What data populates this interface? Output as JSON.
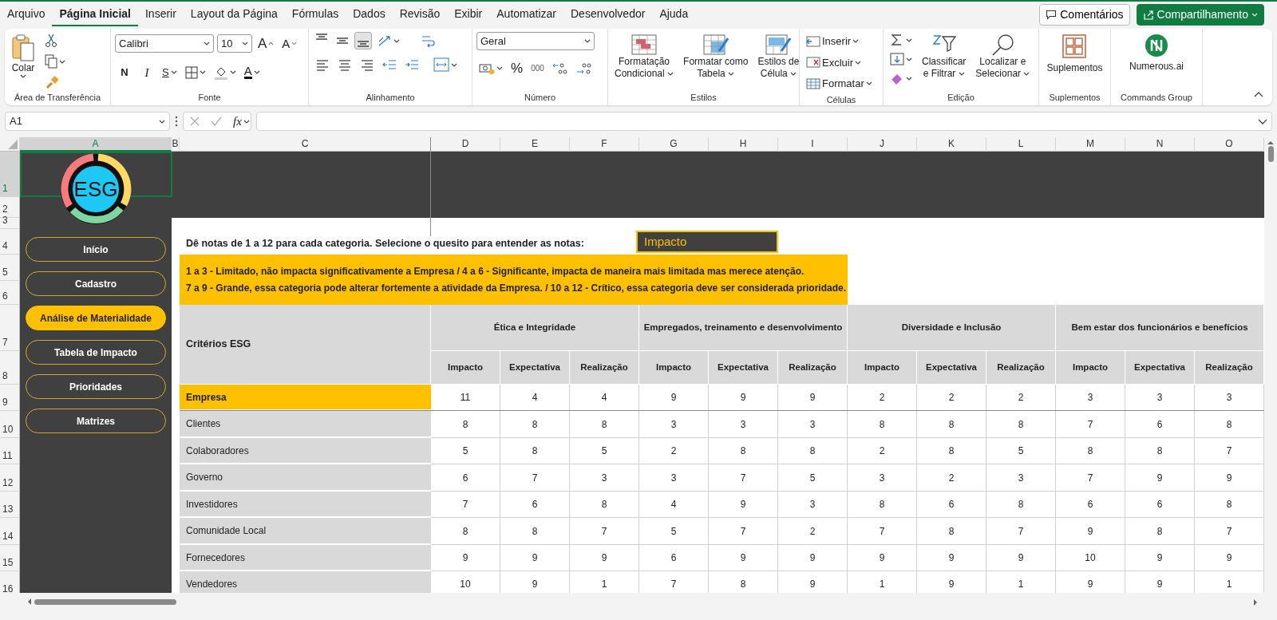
{
  "menu_tabs": [
    {
      "label": "Arquivo",
      "selected": false
    },
    {
      "label": "Página Inicial",
      "selected": true
    },
    {
      "label": "Inserir",
      "selected": false
    },
    {
      "label": "Layout da Página",
      "selected": false
    },
    {
      "label": "Fórmulas",
      "selected": false
    },
    {
      "label": "Dados",
      "selected": false
    },
    {
      "label": "Revisão",
      "selected": false
    },
    {
      "label": "Exibir",
      "selected": false
    },
    {
      "label": "Automatizar",
      "selected": false
    },
    {
      "label": "Desenvolvedor",
      "selected": false
    },
    {
      "label": "Ajuda",
      "selected": false
    }
  ],
  "header_buttons": {
    "comments": "Comentários",
    "share": "Compartilhamento"
  },
  "ribbon": [
    {
      "kind": "clipboard",
      "label": "Área de Transferência",
      "paste": "Colar"
    },
    {
      "kind": "font",
      "label": "Fonte",
      "font_name": "Calibri",
      "font_size": "10",
      "grow": "A",
      "shrink": "A",
      "bold": "N",
      "italic": "I",
      "underline": "S",
      "font_color": "A"
    },
    {
      "kind": "alignment",
      "label": "Alinhamento",
      "vertical": [
        {
          "selected": false
        },
        {
          "selected": false
        },
        {
          "selected": true
        }
      ]
    },
    {
      "kind": "number",
      "label": "Número",
      "format": "Geral",
      "percent": "%",
      "thousands": "000"
    },
    {
      "kind": "styles",
      "label": "Estilos",
      "buttons": [
        {
          "lines": [
            "Formatação",
            "Condicional"
          ]
        },
        {
          "lines": [
            "Formatar como",
            "Tabela"
          ]
        },
        {
          "lines": [
            "Estilos de",
            "Célula"
          ]
        }
      ]
    },
    {
      "kind": "cells",
      "label": "Células",
      "buttons": [
        "Inserir",
        "Excluir",
        "Formatar"
      ]
    },
    {
      "kind": "editing",
      "label": "Edição",
      "buttons": [
        {
          "lines": [
            "Classificar",
            "e Filtrar"
          ]
        },
        {
          "lines": [
            "Localizar e",
            "Selecionar"
          ]
        }
      ]
    },
    {
      "kind": "addins",
      "label": "Suplementos",
      "button": "Suplementos"
    },
    {
      "kind": "commands",
      "label": "Commands Group",
      "button": "Numerous.ai"
    }
  ],
  "formula_bar": {
    "name_box": "A1",
    "fx": "fx"
  },
  "columns": [
    {
      "label": "A",
      "selected": true
    },
    {
      "label": "B",
      "selected": false
    },
    {
      "label": "C",
      "selected": false
    },
    {
      "label": "D",
      "selected": false
    },
    {
      "label": "E",
      "selected": false
    },
    {
      "label": "F",
      "selected": false
    },
    {
      "label": "G",
      "selected": false
    },
    {
      "label": "H",
      "selected": false
    },
    {
      "label": "I",
      "selected": false
    },
    {
      "label": "J",
      "selected": false
    },
    {
      "label": "K",
      "selected": false
    },
    {
      "label": "L",
      "selected": false
    },
    {
      "label": "M",
      "selected": false
    },
    {
      "label": "N",
      "selected": false
    },
    {
      "label": "O",
      "selected": false
    }
  ],
  "rows": [
    {
      "label": "1",
      "selected": true
    },
    {
      "label": "2",
      "selected": false
    },
    {
      "label": "3",
      "selected": false
    },
    {
      "label": "4",
      "selected": false
    },
    {
      "label": "5",
      "selected": false
    },
    {
      "label": "6",
      "selected": false
    },
    {
      "label": "7",
      "selected": false
    },
    {
      "label": "8",
      "selected": false
    },
    {
      "label": "9",
      "selected": false
    },
    {
      "label": "10",
      "selected": false
    },
    {
      "label": "11",
      "selected": false
    },
    {
      "label": "12",
      "selected": false
    },
    {
      "label": "13",
      "selected": false
    },
    {
      "label": "14",
      "selected": false
    },
    {
      "label": "15",
      "selected": false
    },
    {
      "label": "16",
      "selected": false
    }
  ],
  "sheet": {
    "logo_text": "ESG",
    "nav": [
      {
        "label": "Início",
        "selected": false
      },
      {
        "label": "Cadastro",
        "selected": false
      },
      {
        "label": "Análise de Materialidade",
        "selected": true
      },
      {
        "label": "Tabela de Impacto",
        "selected": false
      },
      {
        "label": "Prioridades",
        "selected": false
      },
      {
        "label": "Matrizes",
        "selected": false
      }
    ],
    "instruction": "Dê notas de 1 a 12 para cada categoria. Selecione o quesito para entender as notas:",
    "criterion_select": "Impacto",
    "legend": [
      "1 a 3 - Limitado, não impacta significativamente a Empresa / 4 a 6 - Significante, impacta de maneira mais limitada mas merece atenção.",
      "7 a 9 - Grande, essa categoria pode alterar fortemente a atividade da Empresa. / 10 a 12 - Crítico, essa categoria deve ser considerada prioridade."
    ],
    "table": {
      "corner": "Critérios ESG",
      "groups": [
        {
          "title": "Ética e Integridade",
          "columns": [
            "Impacto",
            "Expectativa",
            "Realização"
          ]
        },
        {
          "title": "Empregados, treinamento e desenvolvimento",
          "columns": [
            "Impacto",
            "Expectativa",
            "Realização"
          ]
        },
        {
          "title": "Diversidade e Inclusão",
          "columns": [
            "Impacto",
            "Expectativa",
            "Realização"
          ]
        },
        {
          "title": "Bem estar dos funcionários e benefícios",
          "columns": [
            "Impacto",
            "Expectativa",
            "Realização"
          ]
        }
      ],
      "rows": [
        {
          "label": "Empresa",
          "highlighted": true,
          "values": [
            "11",
            "4",
            "4",
            "9",
            "9",
            "9",
            "2",
            "2",
            "2",
            "3",
            "3",
            "3"
          ]
        },
        {
          "label": "Clientes",
          "highlighted": false,
          "values": [
            "8",
            "8",
            "8",
            "3",
            "3",
            "3",
            "8",
            "8",
            "8",
            "7",
            "6",
            "8"
          ]
        },
        {
          "label": "Colaboradores",
          "highlighted": false,
          "values": [
            "5",
            "8",
            "5",
            "2",
            "8",
            "8",
            "2",
            "8",
            "5",
            "8",
            "8",
            "7"
          ]
        },
        {
          "label": "Governo",
          "highlighted": false,
          "values": [
            "6",
            "7",
            "3",
            "3",
            "7",
            "5",
            "3",
            "2",
            "3",
            "7",
            "9",
            "9"
          ]
        },
        {
          "label": "Investidores",
          "highlighted": false,
          "values": [
            "7",
            "6",
            "8",
            "4",
            "9",
            "3",
            "8",
            "6",
            "8",
            "6",
            "6",
            "8"
          ]
        },
        {
          "label": "Comunidade Local",
          "highlighted": false,
          "values": [
            "8",
            "8",
            "7",
            "5",
            "7",
            "2",
            "7",
            "8",
            "7",
            "9",
            "8",
            "7"
          ]
        },
        {
          "label": "Fornecedores",
          "highlighted": false,
          "values": [
            "9",
            "9",
            "9",
            "6",
            "9",
            "9",
            "9",
            "9",
            "9",
            "10",
            "9",
            "9"
          ]
        },
        {
          "label": "Vendedores",
          "highlighted": false,
          "values": [
            "10",
            "9",
            "1",
            "7",
            "8",
            "9",
            "1",
            "9",
            "1",
            "9",
            "9",
            "1"
          ]
        }
      ]
    }
  }
}
